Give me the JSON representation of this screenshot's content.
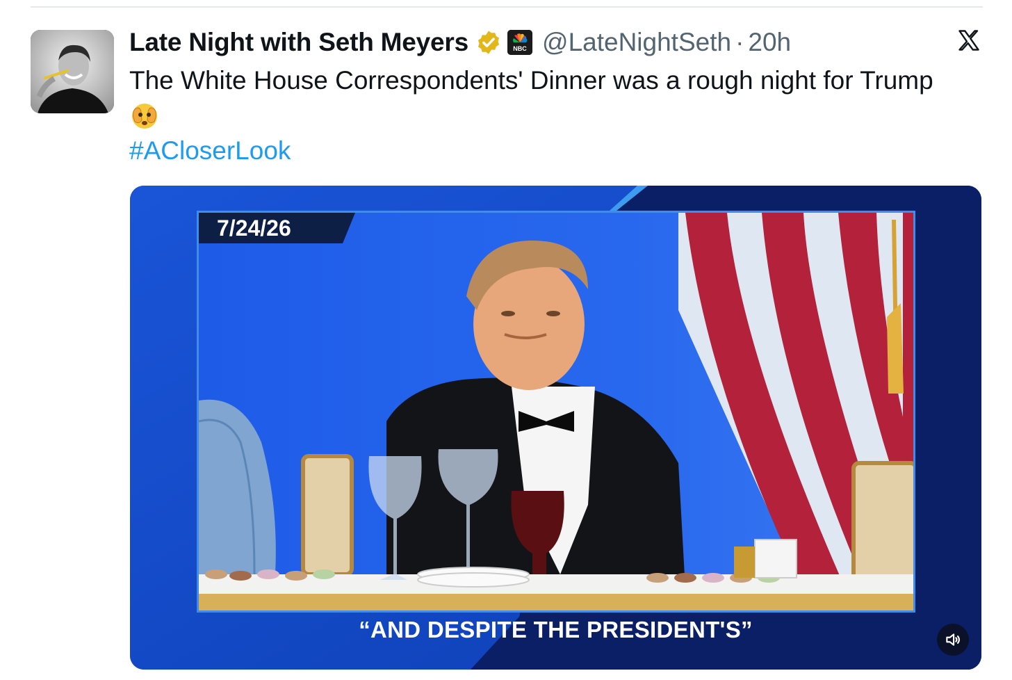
{
  "tweet": {
    "display_name": "Late Night with Seth Meyers",
    "handle": "@LateNightSeth",
    "separator": "·",
    "timestamp": "20h",
    "text": "The White House Correspondents' Dinner was a rough night for Trump",
    "emoji": "face-with-peeking-eye",
    "hashtag": "#ACloserLook"
  },
  "badges": {
    "verified": "verified-gold-badge",
    "affiliate": "nbc-affiliate-badge",
    "affiliate_label": "NBC"
  },
  "media": {
    "date_overlay": "7/24/26",
    "caption": "“AND DESPITE THE PRESIDENT'S”",
    "mute_icon": "speaker-muted-icon"
  },
  "colors": {
    "text_primary": "#0f1419",
    "text_secondary": "#536471",
    "link": "#1d9bf0",
    "verified_gold": "#e2b719",
    "video_blue": "#1147c4"
  },
  "icons": {
    "close": "x-logo-icon"
  }
}
